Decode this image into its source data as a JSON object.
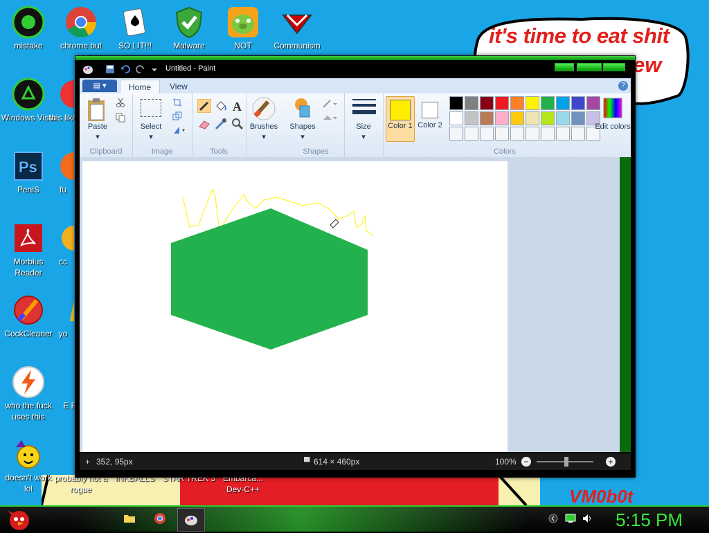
{
  "wallpaper": {
    "speech_line1": "it's time to eat shit",
    "speech_line2": "ew",
    "signature": "VM0b0t"
  },
  "desktop_icons": [
    {
      "label": "mistake",
      "icon": "green-orb-icon"
    },
    {
      "label": "chrome but non",
      "icon": "chrome-icon"
    },
    {
      "label": "SO LIT!!!",
      "icon": "solitaire-icon"
    },
    {
      "label": "Malware",
      "icon": "shield-icon"
    },
    {
      "label": "NOT",
      "icon": "angry-birds-pig-icon"
    },
    {
      "label": "Communism",
      "icon": "red-star-icon"
    },
    {
      "label": "Windows Vista",
      "icon": "recycle-icon"
    },
    {
      "label": "this like",
      "icon": "red-app-icon"
    },
    {
      "label": "PeniS",
      "icon": "photoshop-icon"
    },
    {
      "label": "fu",
      "icon": "firefox-icon"
    },
    {
      "label": "Morbius Reader",
      "icon": "pdf-icon"
    },
    {
      "label": "cc",
      "icon": "yellow-app-icon"
    },
    {
      "label": "CockCleaner",
      "icon": "ccleaner-icon"
    },
    {
      "label": "yo",
      "icon": "yellow-app-icon"
    },
    {
      "label": "who the fuck uses this",
      "icon": "winamp-lightning-icon"
    },
    {
      "label": "E E",
      "icon": "app-icon"
    },
    {
      "label": "doesn't work lol",
      "icon": "yahoo-messenger-icon"
    },
    {
      "label": "probably not a rogue",
      "icon": "app-icon"
    },
    {
      "label": "INKBALLS",
      "icon": "app-icon"
    },
    {
      "label": "STAR TREK 3",
      "icon": "app-icon"
    },
    {
      "label": "Embarca... Dev-C++",
      "icon": "app-icon"
    }
  ],
  "paint": {
    "window_title": "Untitled - Paint",
    "tabs": [
      "Home",
      "View"
    ],
    "groups": {
      "clipboard": {
        "label": "Clipboard",
        "paste": "Paste"
      },
      "image": {
        "label": "Image",
        "select": "Select"
      },
      "tools": {
        "label": "Tools"
      },
      "shapes": {
        "label": "Shapes",
        "brushes": "Brushes",
        "shapes_btn": "Shapes"
      },
      "size": {
        "label": "Size"
      },
      "colors": {
        "label": "Colors",
        "color1": "Color 1",
        "color2": "Color 2",
        "edit": "Edit colors"
      }
    },
    "color1_value": "#ffee00",
    "color2_value": "#ffffff",
    "palette_row1": [
      "#000000",
      "#7f7f7f",
      "#880015",
      "#ed1c24",
      "#ff7f27",
      "#fff200",
      "#22b14c",
      "#00a2e8",
      "#3f48cc",
      "#a349a4"
    ],
    "palette_row2": [
      "#ffffff",
      "#c3c3c3",
      "#b97a57",
      "#ffaec9",
      "#ffc90e",
      "#efe4b0",
      "#b5e61d",
      "#99d9ea",
      "#7092be",
      "#c8bfe7"
    ],
    "status": {
      "cursor_pos": "352, 95px",
      "canvas_size": "614 × 460px",
      "zoom": "100%"
    },
    "shape_fill": "#22b14c",
    "stroke_color": "#fff200"
  },
  "taskbar": {
    "clock": "5:15 PM",
    "start_icon": "angry-bird-icon"
  }
}
